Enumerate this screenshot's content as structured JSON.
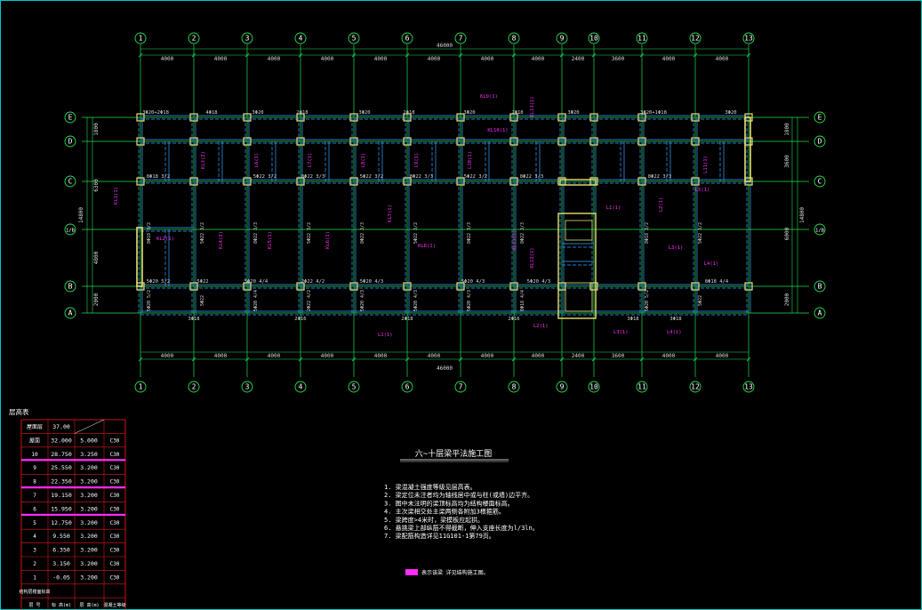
{
  "colors": {
    "background": "#000000",
    "grid": "#22e052",
    "walls": "#3aa0ff",
    "beam_text": "#d8d8d8",
    "annotation": "#ff2cff",
    "column": "#e8e070",
    "frame": "#00c8c8",
    "table_border": "#e01818",
    "table_band": "#ff2cff"
  },
  "axes_x": [
    "1",
    "2",
    "3",
    "4",
    "5",
    "6",
    "7",
    "8",
    "9",
    "10",
    "11",
    "12",
    "13"
  ],
  "axes_y": [
    "E",
    "D",
    "C",
    "1/B",
    "B",
    "A"
  ],
  "dims_top": [
    "4000",
    "4000",
    "4000",
    "4000",
    "4000",
    "4000",
    "4000",
    "4000",
    "2400",
    "3600",
    "4000",
    "4000"
  ],
  "dims_total": "46000",
  "dims_left": [
    "1800",
    "6300",
    "4800",
    "2000"
  ],
  "dims_left_total": "14800",
  "dims_right": [
    "1800",
    "3600",
    "6000",
    "2000"
  ],
  "dims_right_total": "14800",
  "drawing_title": "六~十层梁平法施工图",
  "notes": [
    "1. 梁混凝土强度等级见层高表。",
    "2. 梁定位未注者均为轴线居中或与柱(或墙)边平齐。",
    "3. 图中未注明的梁顶标高均为结构楼面标高。",
    "4. 主次梁相交处主梁两侧各附加3根箍筋。",
    "5. 梁跨度>4米时，梁模板应起拱。",
    "6. 悬挑梁上部纵筋不得截断，伸入支座长度为l/3ln。",
    "7. 梁配筋构造详见11G101-1第79页。"
  ],
  "legend_label": "表示该梁 详见结构施工图。",
  "floor_table": {
    "title": "层高表",
    "rows": [
      {
        "floor": "屋面层",
        "elev": "37.00",
        "height": "",
        "grade": ""
      },
      {
        "floor": "屋面",
        "elev": "32.000",
        "height": "5.000",
        "grade": "C30"
      },
      {
        "floor": "10",
        "elev": "28.750",
        "height": "3.250",
        "grade": "C30"
      },
      {
        "floor": "9",
        "elev": "25.550",
        "height": "3.200",
        "grade": "C30"
      },
      {
        "floor": "8",
        "elev": "22.350",
        "height": "3.200",
        "grade": "C30"
      },
      {
        "floor": "7",
        "elev": "19.150",
        "height": "3.200",
        "grade": "C30"
      },
      {
        "floor": "6",
        "elev": "15.950",
        "height": "3.200",
        "grade": "C30"
      },
      {
        "floor": "5",
        "elev": "12.750",
        "height": "3.200",
        "grade": "C30"
      },
      {
        "floor": "4",
        "elev": "9.550",
        "height": "3.200",
        "grade": "C30"
      },
      {
        "floor": "3",
        "elev": "6.350",
        "height": "3.200",
        "grade": "C30"
      },
      {
        "floor": "2",
        "elev": "3.150",
        "height": "3.200",
        "grade": "C30"
      },
      {
        "floor": "1",
        "elev": "-0.05",
        "height": "3.200",
        "grade": "C30"
      }
    ],
    "footer_label": "结构层楼面标高",
    "headers": [
      "层 号",
      "标 高(m)",
      "层 高(m)",
      "混凝土等级"
    ]
  },
  "beam_labels_top": [
    "3Φ20+2Φ18",
    "4Φ18",
    "3Φ20",
    "2Φ18",
    "3Φ20",
    "2Φ18",
    "3Φ20",
    "2Φ18",
    "3Φ20",
    "3Φ20+1Φ18",
    "3Φ20"
  ],
  "beam_labels_mid": [
    "8Φ18 3/2",
    "5Φ22 3/2",
    "8Φ22 3/3",
    "5Φ22 3/2",
    "8Φ22 3/3",
    "5Φ22 3/2",
    "8Φ22 3/3",
    "8Φ22 3/3"
  ],
  "beam_labels_low": [
    "5Φ20 5/2",
    "5Φ22",
    "5Φ20 4/4",
    "2Φ22 4/2",
    "5Φ20 4/3",
    "5Φ20 4/3",
    "5Φ20 4/3",
    "8Φ18 4/4"
  ],
  "beam_labels_bottom": [
    "3Φ18",
    "2Φ16",
    "2Φ18",
    "2Φ16",
    "3Φ18",
    "3Φ18"
  ],
  "magenta_tags": [
    "KL1(1)",
    "KL2(1)",
    "KL3(2)",
    "KL4(2)",
    "KL5(1)",
    "KL6(1)",
    "KL7(1)",
    "KL8(1)",
    "KL9(1)",
    "KL10(1)",
    "KL11(1)",
    "KL12(1)",
    "KL13(1)",
    "L1(1)",
    "L2(1)",
    "L3(1)",
    "L4(1)",
    "L5(1)",
    "L6(1)",
    "L7(1)",
    "L8(1)",
    "L9(1)",
    "L10(1)",
    "L11(1)"
  ]
}
